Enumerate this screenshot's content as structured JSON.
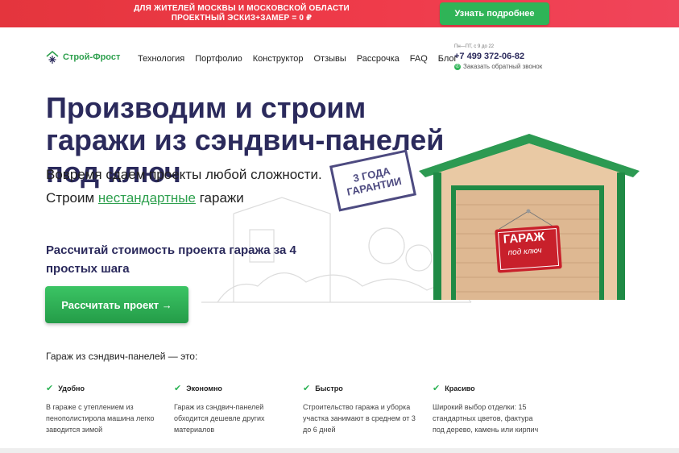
{
  "topbar": {
    "promo_line1": "ДЛЯ ЖИТЕЛЕЙ МОСКВЫ И МОСКОВСКОЙ ОБЛАСТИ",
    "promo_line2": "ПРОЕКТНЫЙ ЭСКИЗ+ЗАМЕР = 0 ₽",
    "cta_label": "Узнать подробнее"
  },
  "logo": {
    "brand": "Строй-Фрост",
    "icon": "snowflake-house-icon"
  },
  "nav": [
    "Технология",
    "Портфолио",
    "Конструктор",
    "Отзывы",
    "Рассрочка",
    "FAQ",
    "Блог"
  ],
  "contact": {
    "hours": "Пн—ПТ, с 9 до 22",
    "phone": "+7 499 372-06-82",
    "callback": "Заказать обратный звонок"
  },
  "hero": {
    "title": "Производим и строим гаражи из сэндвич-панелей под ключ",
    "sub1": "Вовремя сдаем проекты любой сложности.",
    "sub2_pre": "Строим ",
    "sub2_highlight": "нестандартные",
    "sub2_post": " гаражи",
    "stamp": "3 ГОДА ГАРАНТИИ",
    "calc_title": "Рассчитай стоимость проекта гаража за 4 простых шага",
    "calc_button": "Рассчитать проект →",
    "garage_sign_line1": "ГАРАЖ",
    "garage_sign_line2": "под ключ"
  },
  "features": {
    "title": "Гараж из сэндвич-панелей — это:",
    "items": [
      {
        "title": "Удобно",
        "desc": "В гараже с утеплением из пенополистирола машина легко заводится зимой"
      },
      {
        "title": "Экономно",
        "desc": "Гараж из сэндвич-панелей обходится дешевле других материалов"
      },
      {
        "title": "Быстро",
        "desc": "Строительство гаража и уборка участка занимают в среднем от 3 до 6 дней"
      },
      {
        "title": "Красиво",
        "desc": "Широкий выбор отделки: 15 стандартных цветов, фактура под дерево, камень или кирпич"
      }
    ]
  },
  "colors": {
    "brand_green": "#2ea04e",
    "title_navy": "#2b2a5c",
    "promo_red": "#e4353d"
  }
}
